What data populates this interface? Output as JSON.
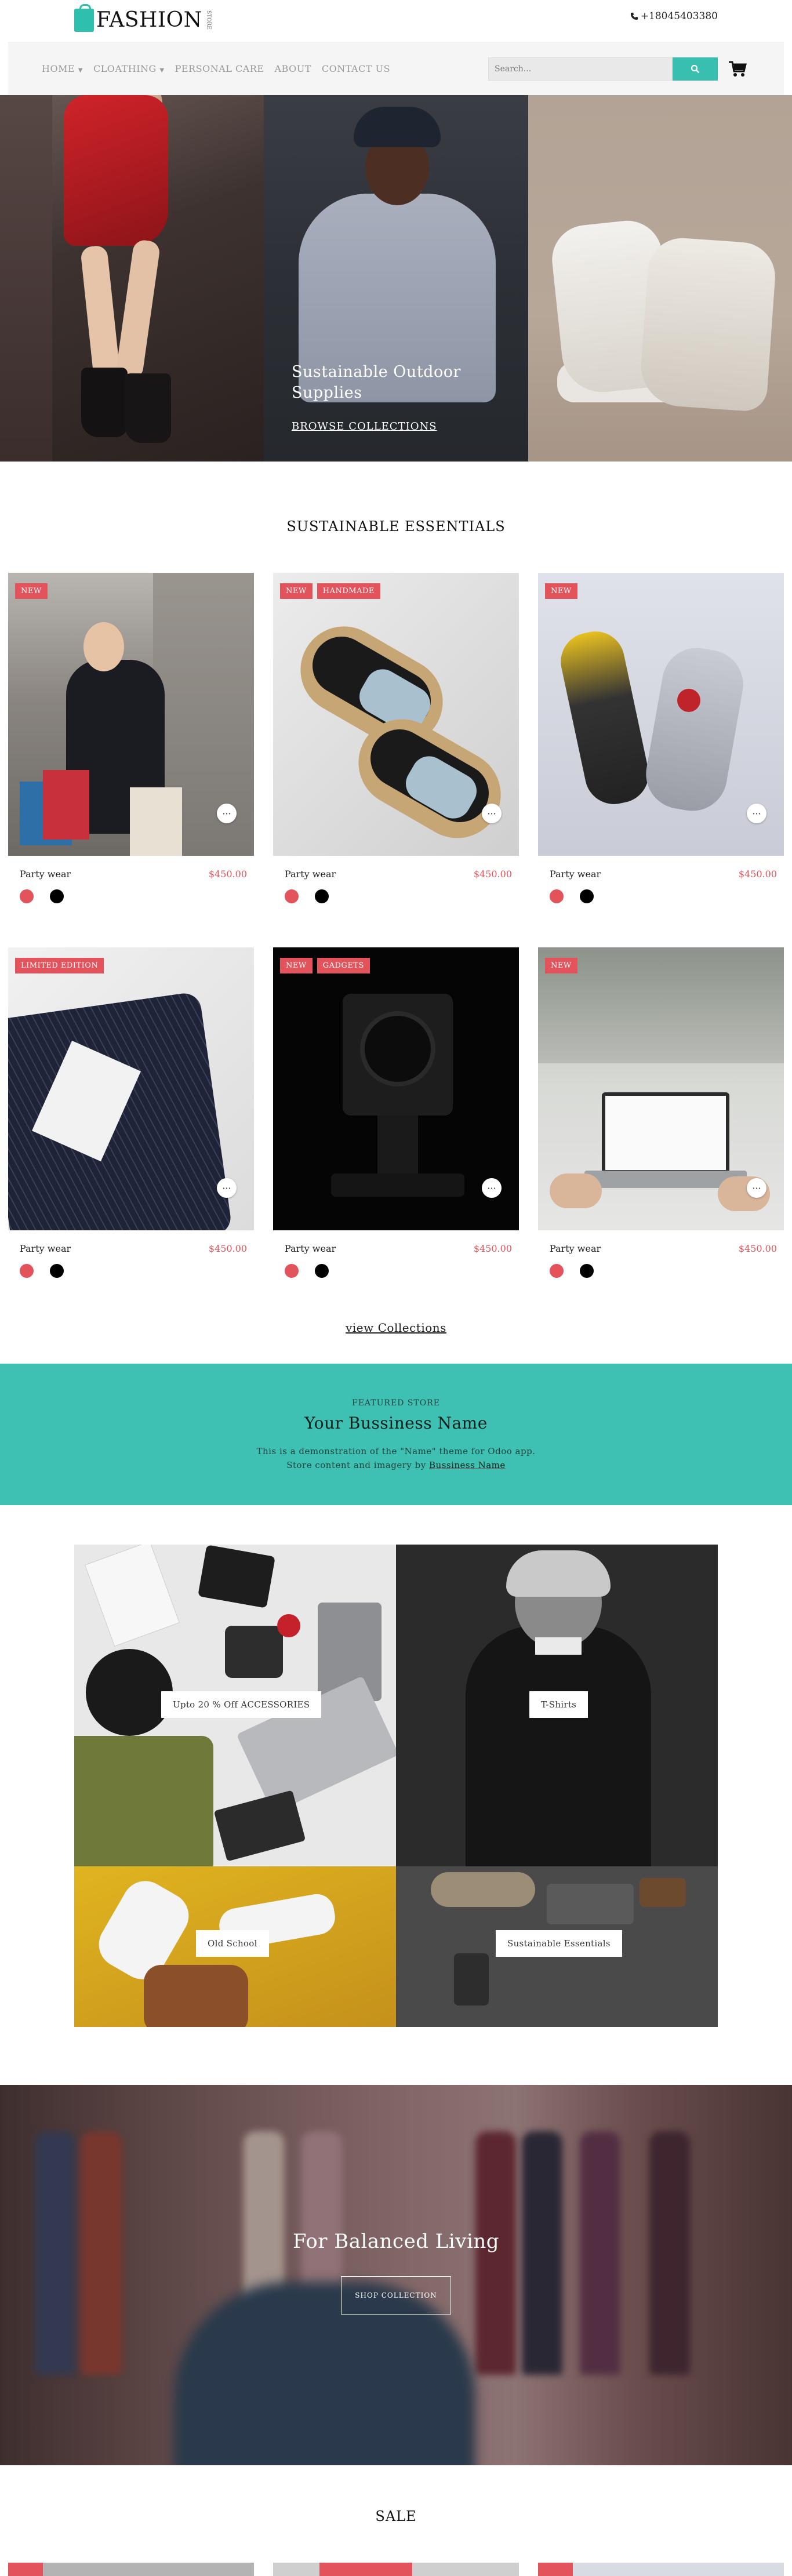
{
  "header": {
    "logo_text": "FASHION",
    "logo_sub": "STORE",
    "phone": "+18045403380"
  },
  "nav": {
    "items": [
      {
        "label": "HOME",
        "dropdown": true
      },
      {
        "label": "CLOATHING",
        "dropdown": true
      },
      {
        "label": "PERSONAL CARE",
        "dropdown": false
      },
      {
        "label": "ABOUT",
        "dropdown": false
      },
      {
        "label": "CONTACT US",
        "dropdown": false
      }
    ],
    "search_placeholder": "Search...",
    "accent": "#39bfb0"
  },
  "hero": {
    "title_line1": "Sustainable Outdoor",
    "title_line2": "Supplies",
    "link": "BROWSE COLLECTIONS"
  },
  "essentials": {
    "title": "SUSTAINABLE ESSENTIALS",
    "products": [
      {
        "name": "Party wear",
        "price": "$450.00",
        "badges": [
          "NEW"
        ]
      },
      {
        "name": "Party wear",
        "price": "$450.00",
        "badges": [
          "NEW",
          "HANDMADE"
        ]
      },
      {
        "name": "Party wear",
        "price": "$450.00",
        "badges": [
          "NEW"
        ]
      },
      {
        "name": "Party wear",
        "price": "$450.00",
        "badges": [
          "LIMITED EDITION"
        ]
      },
      {
        "name": "Party wear",
        "price": "$450.00",
        "badges": [
          "NEW",
          "GADGETS"
        ]
      },
      {
        "name": "Party wear",
        "price": "$450.00",
        "badges": [
          "NEW"
        ]
      }
    ],
    "more_icon": "ellipsis-icon",
    "badge_color": "#e2535b",
    "view_link": "view Collections"
  },
  "featured": {
    "kicker": "FEATURED STORE",
    "title": "Your Bussiness Name",
    "text_line1": "This is a demonstration of the \"Name\" theme for Odoo app.",
    "text_line2": "Store content and imagery by",
    "link": "Bussiness Name",
    "bg": "#3ec0b2"
  },
  "collage": {
    "tiles": [
      "Upto 20 % Off ACCESSORIES",
      "T-Shirts",
      "Old School",
      "Sustainable Essentials"
    ]
  },
  "balanced": {
    "title": "For Balanced Living",
    "button": "SHOP COLLECTION"
  },
  "sale": {
    "title": "SALE"
  }
}
